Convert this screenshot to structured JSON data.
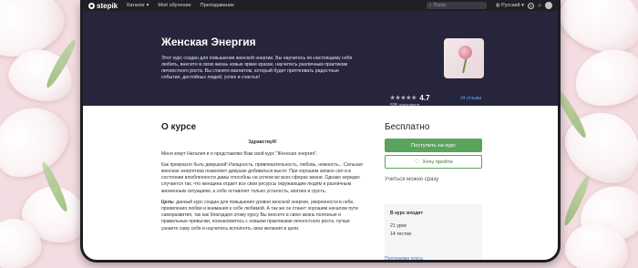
{
  "navbar": {
    "brand": "stepik",
    "menu": [
      "Каталог",
      "Моё обучение",
      "Преподавание"
    ],
    "search_placeholder": "Поиск",
    "language": "Русский",
    "notifications": "0",
    "catalog_caret": "▾",
    "lang_caret": "▾"
  },
  "course": {
    "title": "Женская Энергия",
    "description": "Этот курс создан для повышения женской энергии. Вы научитесь по-настоящему себя любить, внесете в свою жизнь новые яркие краски, научитесь различным практикам личностного роста. Вы станете магнитом, который будет притягивать радостные события, достойных людей, успех и счастье!",
    "rating": "4.7",
    "stars": "★★★★★",
    "learners": "505 учащихся",
    "reviews": "24 отзыва"
  },
  "about": {
    "title": "О курсе",
    "greeting": "Здравствуй!",
    "paragraphs": [
      "Меня зовут Наталия и я представляю Вам свой курс \"Женская энергия\".",
      "Как прекрасно быть девушкой! Изящность, привлекательность, любовь, нежность... Сильная женская энергетика позволяет девушке добиваться высот. При хорошем запасе сил и в состоянии влюбленности дамы способны на успехи во всех сферах жизни. Однако нередко случается так, что женщина отдает все свои ресурсы окружающим людям и различным жизненным ситуациям, а себе оставляет только усталость, апатию и грусть.",
      "данный курс создан для повышения уровня женской энергии, уверенности в себе, проявления любви и внимания к себе любимой. А так же он станет хорошим началом пути саморазвития, так как благодаря этому курсу Вы внесете в свою жизнь полезные и правильные привычки, познакомитесь с новыми практиками личностного роста, лучше узнаете саму себя и научитесь исполнять свои желания и цели."
    ],
    "goal_label": "Цель:"
  },
  "sidebar": {
    "price": "Бесплатно",
    "enroll_label": "Поступить на курс",
    "wishlist_label": "Хочу пройти",
    "learn_now": "Учиться можно сразу",
    "includes_title": "В курс входят",
    "lessons": "21 урок",
    "tests": "14 тестов",
    "program_link": "Программа курса"
  },
  "colors": {
    "hero_bg": "#26253b",
    "accent_green": "#5aa35c",
    "link_blue": "#3e7bd8"
  },
  "icons": [
    "search-icon",
    "globe-icon",
    "heart-icon",
    "bell-icon"
  ]
}
